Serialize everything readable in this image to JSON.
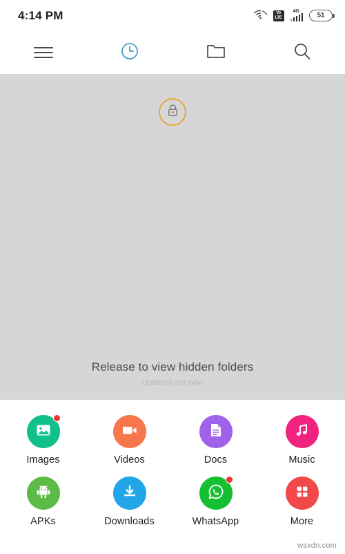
{
  "status_bar": {
    "time": "4:14 PM",
    "wifi_icon": "wifi-icon",
    "volte_line1": "Vo",
    "volte_line2": "LTE",
    "network_type": "4G",
    "signal_icon": "signal-bars-icon",
    "battery_level": "51"
  },
  "toolbar": {
    "menu_icon": "hamburger-menu-icon",
    "recent_icon": "clock-recent-icon",
    "folder_icon": "folder-icon",
    "search_icon": "search-icon",
    "active_color": "#3f9cbf",
    "inactive_color": "#4a4a4a"
  },
  "pull_refresh": {
    "lock_icon": "lock-icon",
    "ring_color": "#eda43a",
    "message": "Release to view hidden folders",
    "sub_message": "Updated just now",
    "panel_color": "#d6d6d6"
  },
  "categories": [
    {
      "label": "Images",
      "icon": "image-icon",
      "color": "#10c08b",
      "badge": true
    },
    {
      "label": "Videos",
      "icon": "video-icon",
      "color": "#f8764c",
      "badge": false
    },
    {
      "label": "Docs",
      "icon": "document-icon",
      "color": "#a062ea",
      "badge": false
    },
    {
      "label": "Music",
      "icon": "music-note-icon",
      "color": "#f0247e",
      "badge": false
    },
    {
      "label": "APKs",
      "icon": "android-icon",
      "color": "#5cbb46",
      "badge": false
    },
    {
      "label": "Downloads",
      "icon": "download-icon",
      "color": "#22a6e8",
      "badge": false
    },
    {
      "label": "WhatsApp",
      "icon": "whatsapp-icon",
      "color": "#14c031",
      "badge": true
    },
    {
      "label": "More",
      "icon": "grid-more-icon",
      "color": "#f2484a",
      "badge": false
    }
  ],
  "watermark": {
    "text": "wsxdn.com"
  }
}
